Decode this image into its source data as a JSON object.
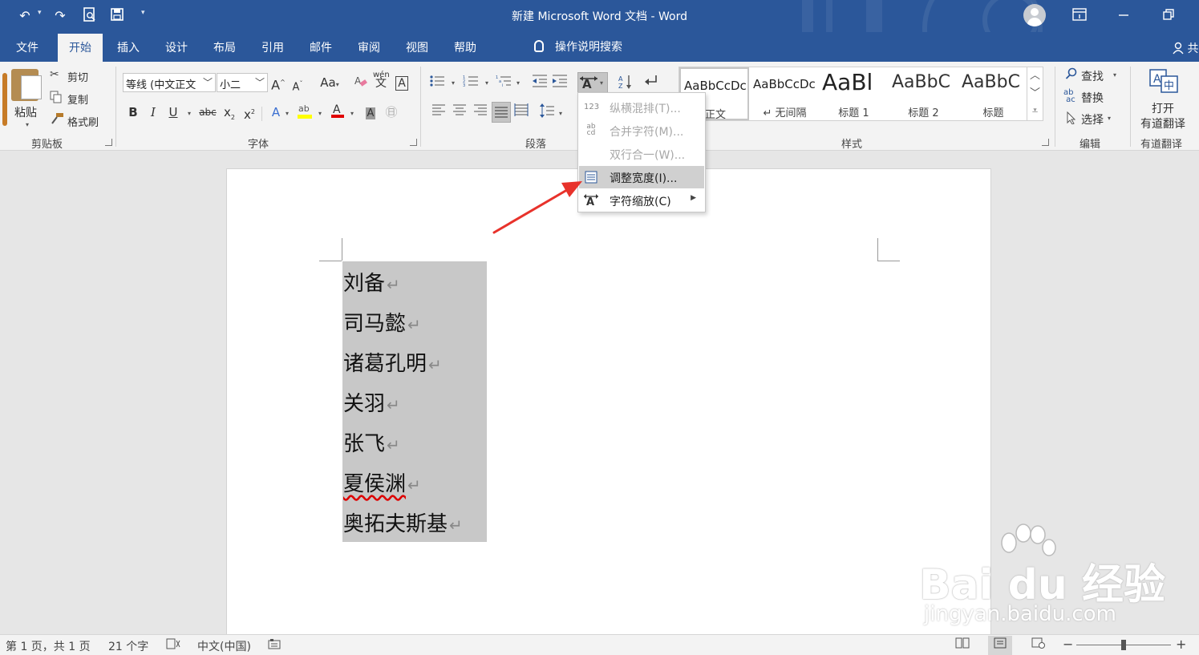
{
  "window": {
    "title": "新建 Microsoft Word 文档  -  Word",
    "titlebar_color": "#2b579a"
  },
  "quick_access": {
    "icons": [
      "undo-icon",
      "redo-icon",
      "print-preview-icon",
      "save-icon",
      "customize-icon"
    ]
  },
  "tabs": [
    {
      "label": "文件"
    },
    {
      "label": "开始",
      "active": true
    },
    {
      "label": "插入"
    },
    {
      "label": "设计"
    },
    {
      "label": "布局"
    },
    {
      "label": "引用"
    },
    {
      "label": "邮件"
    },
    {
      "label": "审阅"
    },
    {
      "label": "视图"
    },
    {
      "label": "帮助"
    }
  ],
  "tell_me": "操作说明搜索",
  "share": "共",
  "ribbon": {
    "clipboard": {
      "label": "剪贴板",
      "paste": "粘贴",
      "cut": "剪切",
      "copy": "复制",
      "format_painter": "格式刷"
    },
    "font": {
      "label": "字体",
      "font_name": "等线 (中文正文",
      "font_size": "小二",
      "grow": "A",
      "shrink": "A",
      "change_case": "Aa",
      "bold": "B",
      "italic": "I",
      "underline": "U",
      "strikethrough": "abc",
      "subscript": "x",
      "superscript": "x",
      "phonetic": "wén",
      "char_border": "A",
      "font_color": "#e00000",
      "highlight_color": "#ffff00"
    },
    "paragraph": {
      "label": "段落"
    },
    "styles": {
      "label": "样式",
      "items": [
        {
          "sample": "AaBbCcDc",
          "name": "正文",
          "active": true
        },
        {
          "sample": "AaBbCcDc",
          "name": "↵ 无间隔"
        },
        {
          "sample": "AaBl",
          "name": "标题 1"
        },
        {
          "sample": "AaBbC",
          "name": "标题 2"
        },
        {
          "sample": "AaBbC",
          "name": "标题"
        }
      ]
    },
    "editing": {
      "label": "编辑",
      "find": "查找",
      "replace": "替换",
      "select": "选择"
    },
    "youdao": {
      "label": "有道翻译",
      "button_line1": "打开",
      "button_line2": "有道翻译"
    }
  },
  "asian_layout_menu": {
    "items": [
      {
        "label": "纵横混排(T)...",
        "icon": "vertical-in-horizontal-icon",
        "disabled": true
      },
      {
        "label": "合并字符(M)...",
        "icon": "combine-characters-icon",
        "disabled": true
      },
      {
        "label": "双行合一(W)...",
        "icon": "",
        "disabled": true
      },
      {
        "label": "调整宽度(I)...",
        "icon": "fit-text-icon",
        "highlighted": true
      },
      {
        "label": "字符缩放(C)",
        "icon": "character-scale-icon",
        "submenu": true
      }
    ]
  },
  "document": {
    "paragraphs": [
      "刘备",
      "司马懿",
      "诸葛孔明",
      "关羽",
      "张飞",
      "夏侯渊",
      "奥拓夫斯基"
    ],
    "paragraph_mark": "↵",
    "selection_color": "#c8c8c8"
  },
  "annotation": {
    "arrow_color": "#e8322b"
  },
  "watermark": {
    "brand": "Bai du 经验",
    "url": "jingyan.baidu.com"
  },
  "status_bar": {
    "page": "第 1 页，共 1 页",
    "words": "21 个字",
    "language": "中文(中国)",
    "zoom_minus": "−",
    "zoom_plus": "+",
    "zoom_fraction": 0.5
  }
}
